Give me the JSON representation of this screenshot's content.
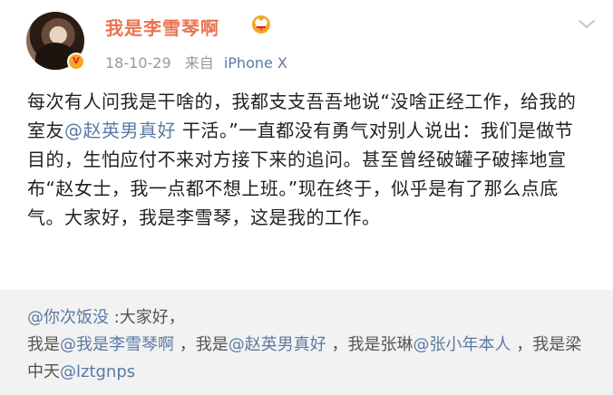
{
  "post": {
    "username": "我是李雪琴啊",
    "date": "18-10-29",
    "from_label": "来自",
    "device": "iPhone X",
    "content": {
      "p1": "每次有人问我是干啥的，我都支支吾吾地说“没啥正经工作，给我的室友",
      "m1": "@赵英男真好",
      "p2": " 干活。”一直都没有勇气对别人说出：我们是做节目的，生怕应付不来对方接下来的追问。甚至曾经破罐子破摔地宣布“赵女士，我一点都不想上班。”现在终于，似乎是有了那么点底气。大家好，我是李雪琴，这是我的工作。"
    }
  },
  "repost": {
    "m_user": "@你次饭没",
    "t1": " :大家好，",
    "t2": "我是",
    "m2": "@我是李雪琴啊",
    "t3": " ，我是",
    "m3": "@赵英男真好",
    "t4": " ，我是张琳",
    "m4": "@张小年本人",
    "t5": " ，我是梁中天",
    "m5": "@lztgnps"
  },
  "colors": {
    "username": "#eb7350",
    "mention": "#5b7aa4",
    "repost_bg": "#f2f2f2"
  },
  "icons": {
    "avatar_badge": "verified-badge-icon",
    "vip": "vip-crown-icon",
    "menu": "chevron-down-icon"
  }
}
